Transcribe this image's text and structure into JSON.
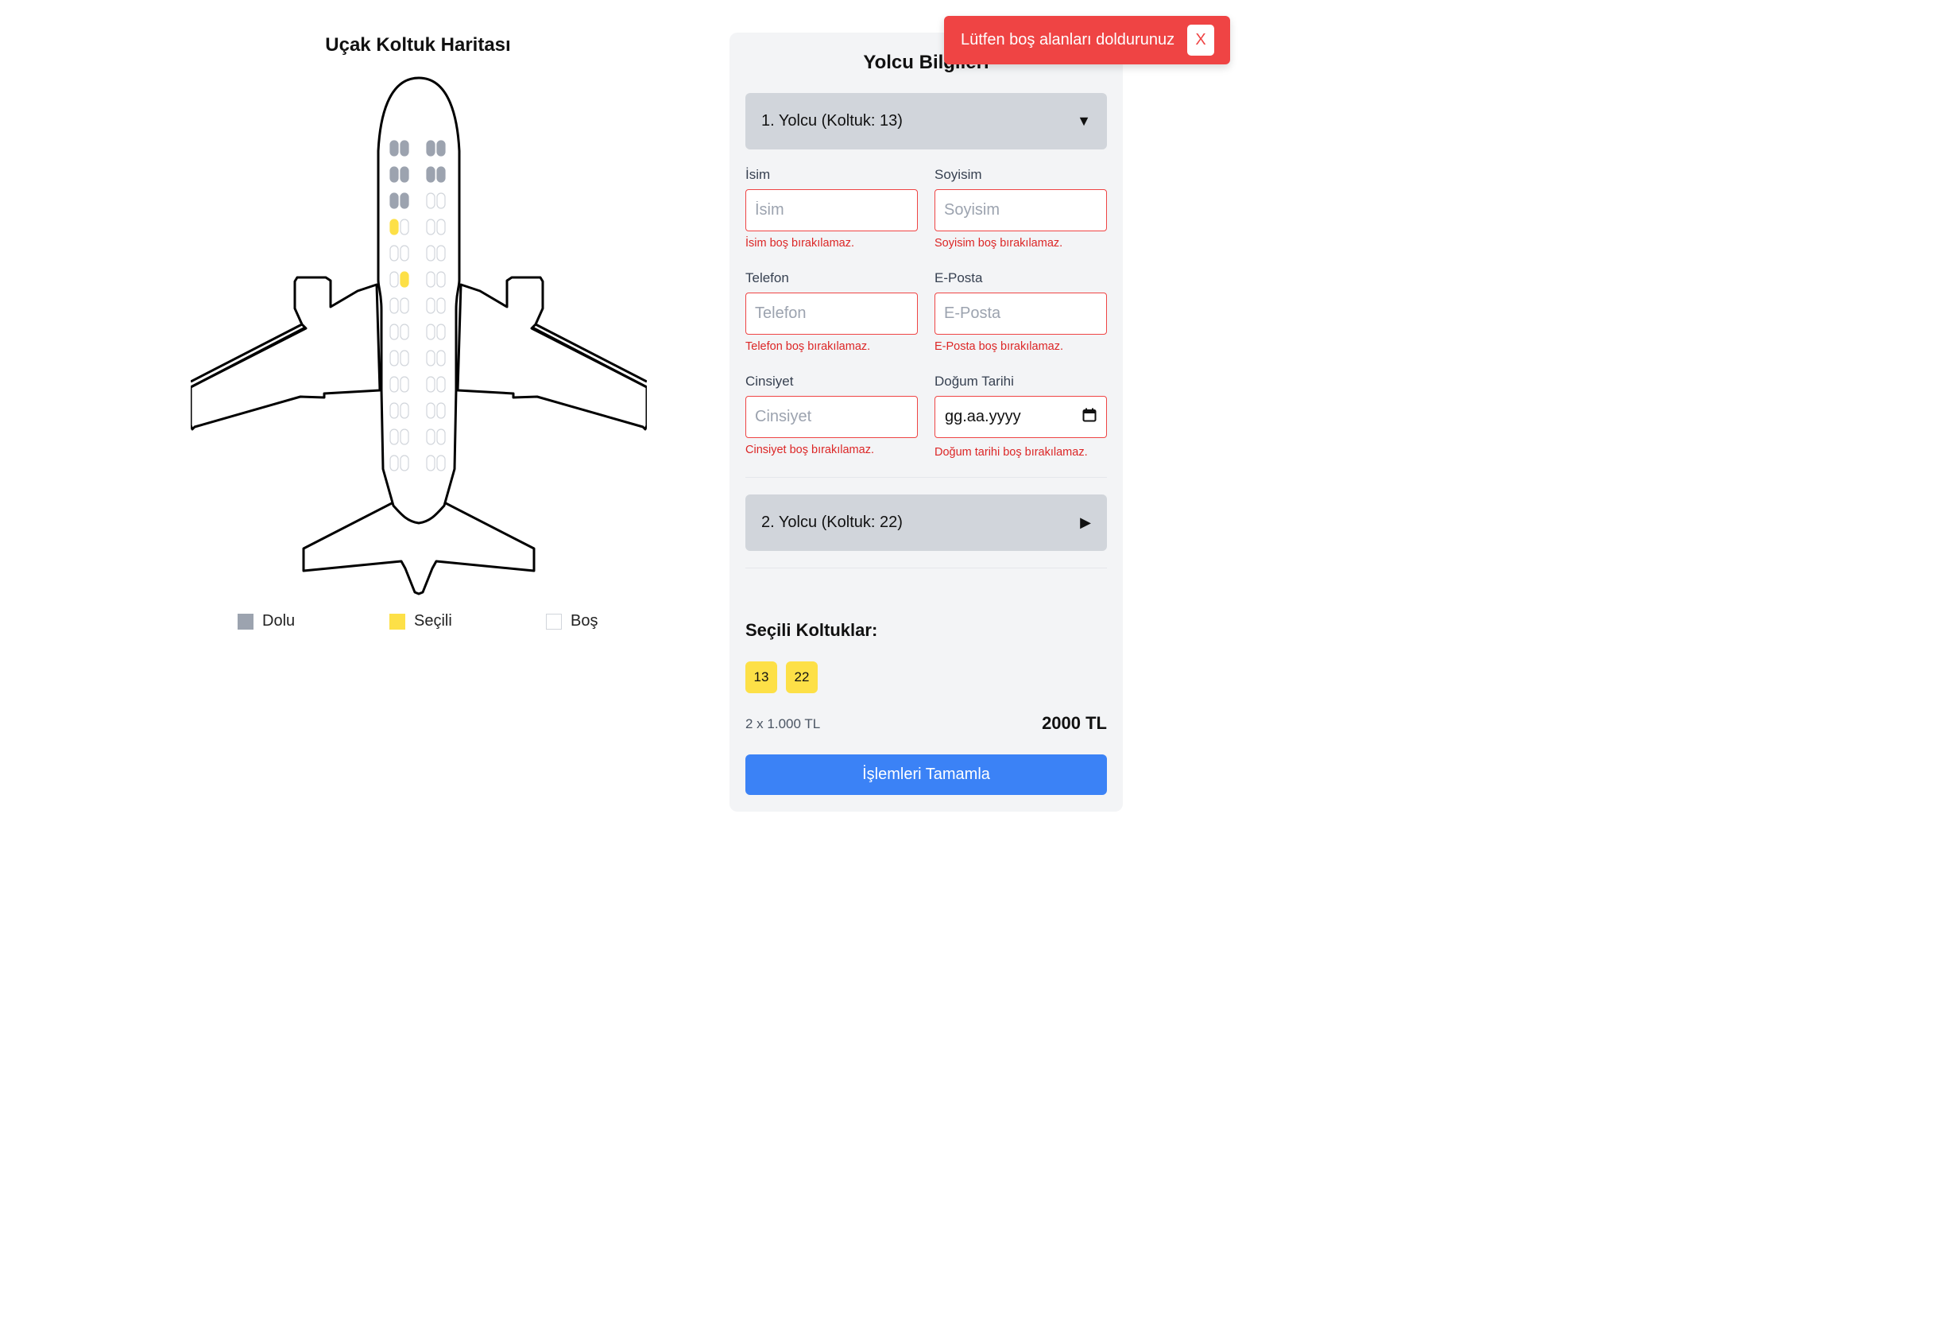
{
  "seat_map": {
    "title": "Uçak Koltuk Haritası",
    "seat_rows": [
      [
        "dolu",
        "dolu",
        "dolu",
        "dolu"
      ],
      [
        "dolu",
        "dolu",
        "dolu",
        "dolu"
      ],
      [
        "dolu",
        "dolu",
        "bos",
        "bos"
      ],
      [
        "secili",
        "bos",
        "bos",
        "bos"
      ],
      [
        "bos",
        "bos",
        "bos",
        "bos"
      ],
      [
        "bos",
        "secili",
        "bos",
        "bos"
      ],
      [
        "bos",
        "bos",
        "bos",
        "bos"
      ],
      [
        "bos",
        "bos",
        "bos",
        "bos"
      ],
      [
        "bos",
        "bos",
        "bos",
        "bos"
      ],
      [
        "bos",
        "bos",
        "bos",
        "bos"
      ],
      [
        "bos",
        "bos",
        "bos",
        "bos"
      ],
      [
        "bos",
        "bos",
        "bos",
        "bos"
      ],
      [
        "bos",
        "bos",
        "bos",
        "bos"
      ]
    ],
    "legend": [
      {
        "key": "dolu",
        "label": "Dolu",
        "color": "#9ca3af"
      },
      {
        "key": "secili",
        "label": "Seçili",
        "color": "#fde047"
      },
      {
        "key": "bos",
        "label": "Boş",
        "color": "#ffffff"
      }
    ]
  },
  "panel": {
    "title": "Yolcu Bilgileri",
    "passengers": [
      {
        "header": "1. Yolcu (Koltuk: 13)",
        "expanded": true,
        "arrow_icon": "triangle-down-icon",
        "fields": {
          "name": {
            "label": "İsim",
            "placeholder": "İsim",
            "error": "İsim boş bırakılamaz."
          },
          "surname": {
            "label": "Soyisim",
            "placeholder": "Soyisim",
            "error": "Soyisim boş bırakılamaz."
          },
          "phone": {
            "label": "Telefon",
            "placeholder": "Telefon",
            "error": "Telefon boş bırakılamaz."
          },
          "email": {
            "label": "E-Posta",
            "placeholder": "E-Posta",
            "error": "E-Posta boş bırakılamaz."
          },
          "gender": {
            "label": "Cinsiyet",
            "placeholder": "Cinsiyet",
            "error": "Cinsiyet boş bırakılamaz."
          },
          "birthdate": {
            "label": "Doğum Tarihi",
            "placeholder": "gg.aa.yyyy",
            "error": "Doğum tarihi boş bırakılamaz.",
            "icon": "calendar-icon"
          }
        }
      },
      {
        "header": "2. Yolcu (Koltuk: 22)",
        "expanded": false,
        "arrow_icon": "triangle-right-icon"
      }
    ],
    "selected_seats_title": "Seçili Koltuklar:",
    "selected_seats": [
      "13",
      "22"
    ],
    "price_calc": "2 x 1.000 TL",
    "total": "2000 TL",
    "complete_button": "İşlemleri Tamamla"
  },
  "toast": {
    "message": "Lütfen boş alanları doldurunuz",
    "close_label": "X",
    "color": "#ef4444"
  }
}
